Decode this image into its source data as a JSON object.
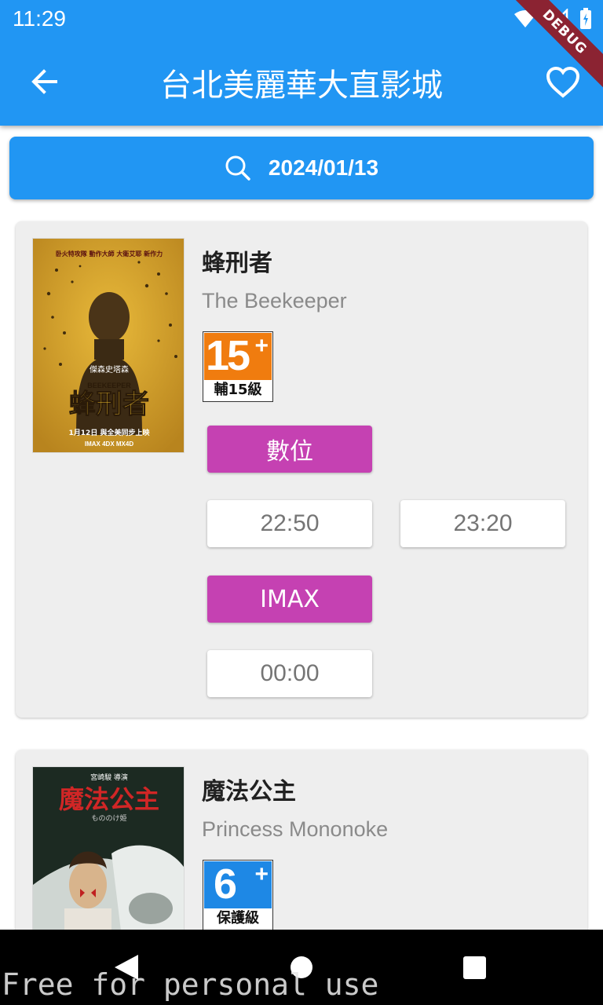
{
  "status_bar": {
    "time": "11:29",
    "icons": [
      "wifi-icon",
      "signal-icon",
      "battery-icon"
    ]
  },
  "app_bar": {
    "title": "台北美麗華大直影城",
    "back_icon": "arrow-back-icon",
    "favorite_icon": "heart-outline-icon",
    "debug_banner": "DEBUG",
    "color": "#2196F3"
  },
  "date_picker": {
    "icon": "search-icon",
    "date": "2024/01/13"
  },
  "movies": [
    {
      "title": "蜂刑者",
      "english_title": "The Beekeeper",
      "rating": {
        "number": "15",
        "plus": "+",
        "label": "輔15級",
        "color": "#F07C0F"
      },
      "sessions": [
        {
          "format": "數位",
          "times": [
            "22:50",
            "23:20"
          ]
        },
        {
          "format": "IMAX",
          "times": [
            "00:00"
          ]
        }
      ],
      "poster": {
        "top_text": "卧火特攻隊 動作大師 大衛艾耶 新作力",
        "actor": "傑森史塔森",
        "logo_en": "BEEKEEPER",
        "logo_zh": "蜂刑者",
        "release": "1月12日 與全美同步上映",
        "formats": "IMAX 4DX MX4D"
      }
    },
    {
      "title": "魔法公主",
      "english_title": "Princess Mononoke",
      "rating": {
        "number": "6",
        "plus": "+",
        "label": "保護級",
        "color": "#1E88E5"
      },
      "poster": {
        "director": "宮崎駿 導演",
        "title": "魔法公主",
        "subtitle": "もののけ姫"
      }
    }
  ],
  "colors": {
    "format_button": "#C541B2",
    "card_background": "#EEEEEE"
  },
  "nav_bar": {
    "icons": [
      "back-triangle-icon",
      "home-circle-icon",
      "recents-square-icon"
    ]
  },
  "watermark": "Free for personal use"
}
